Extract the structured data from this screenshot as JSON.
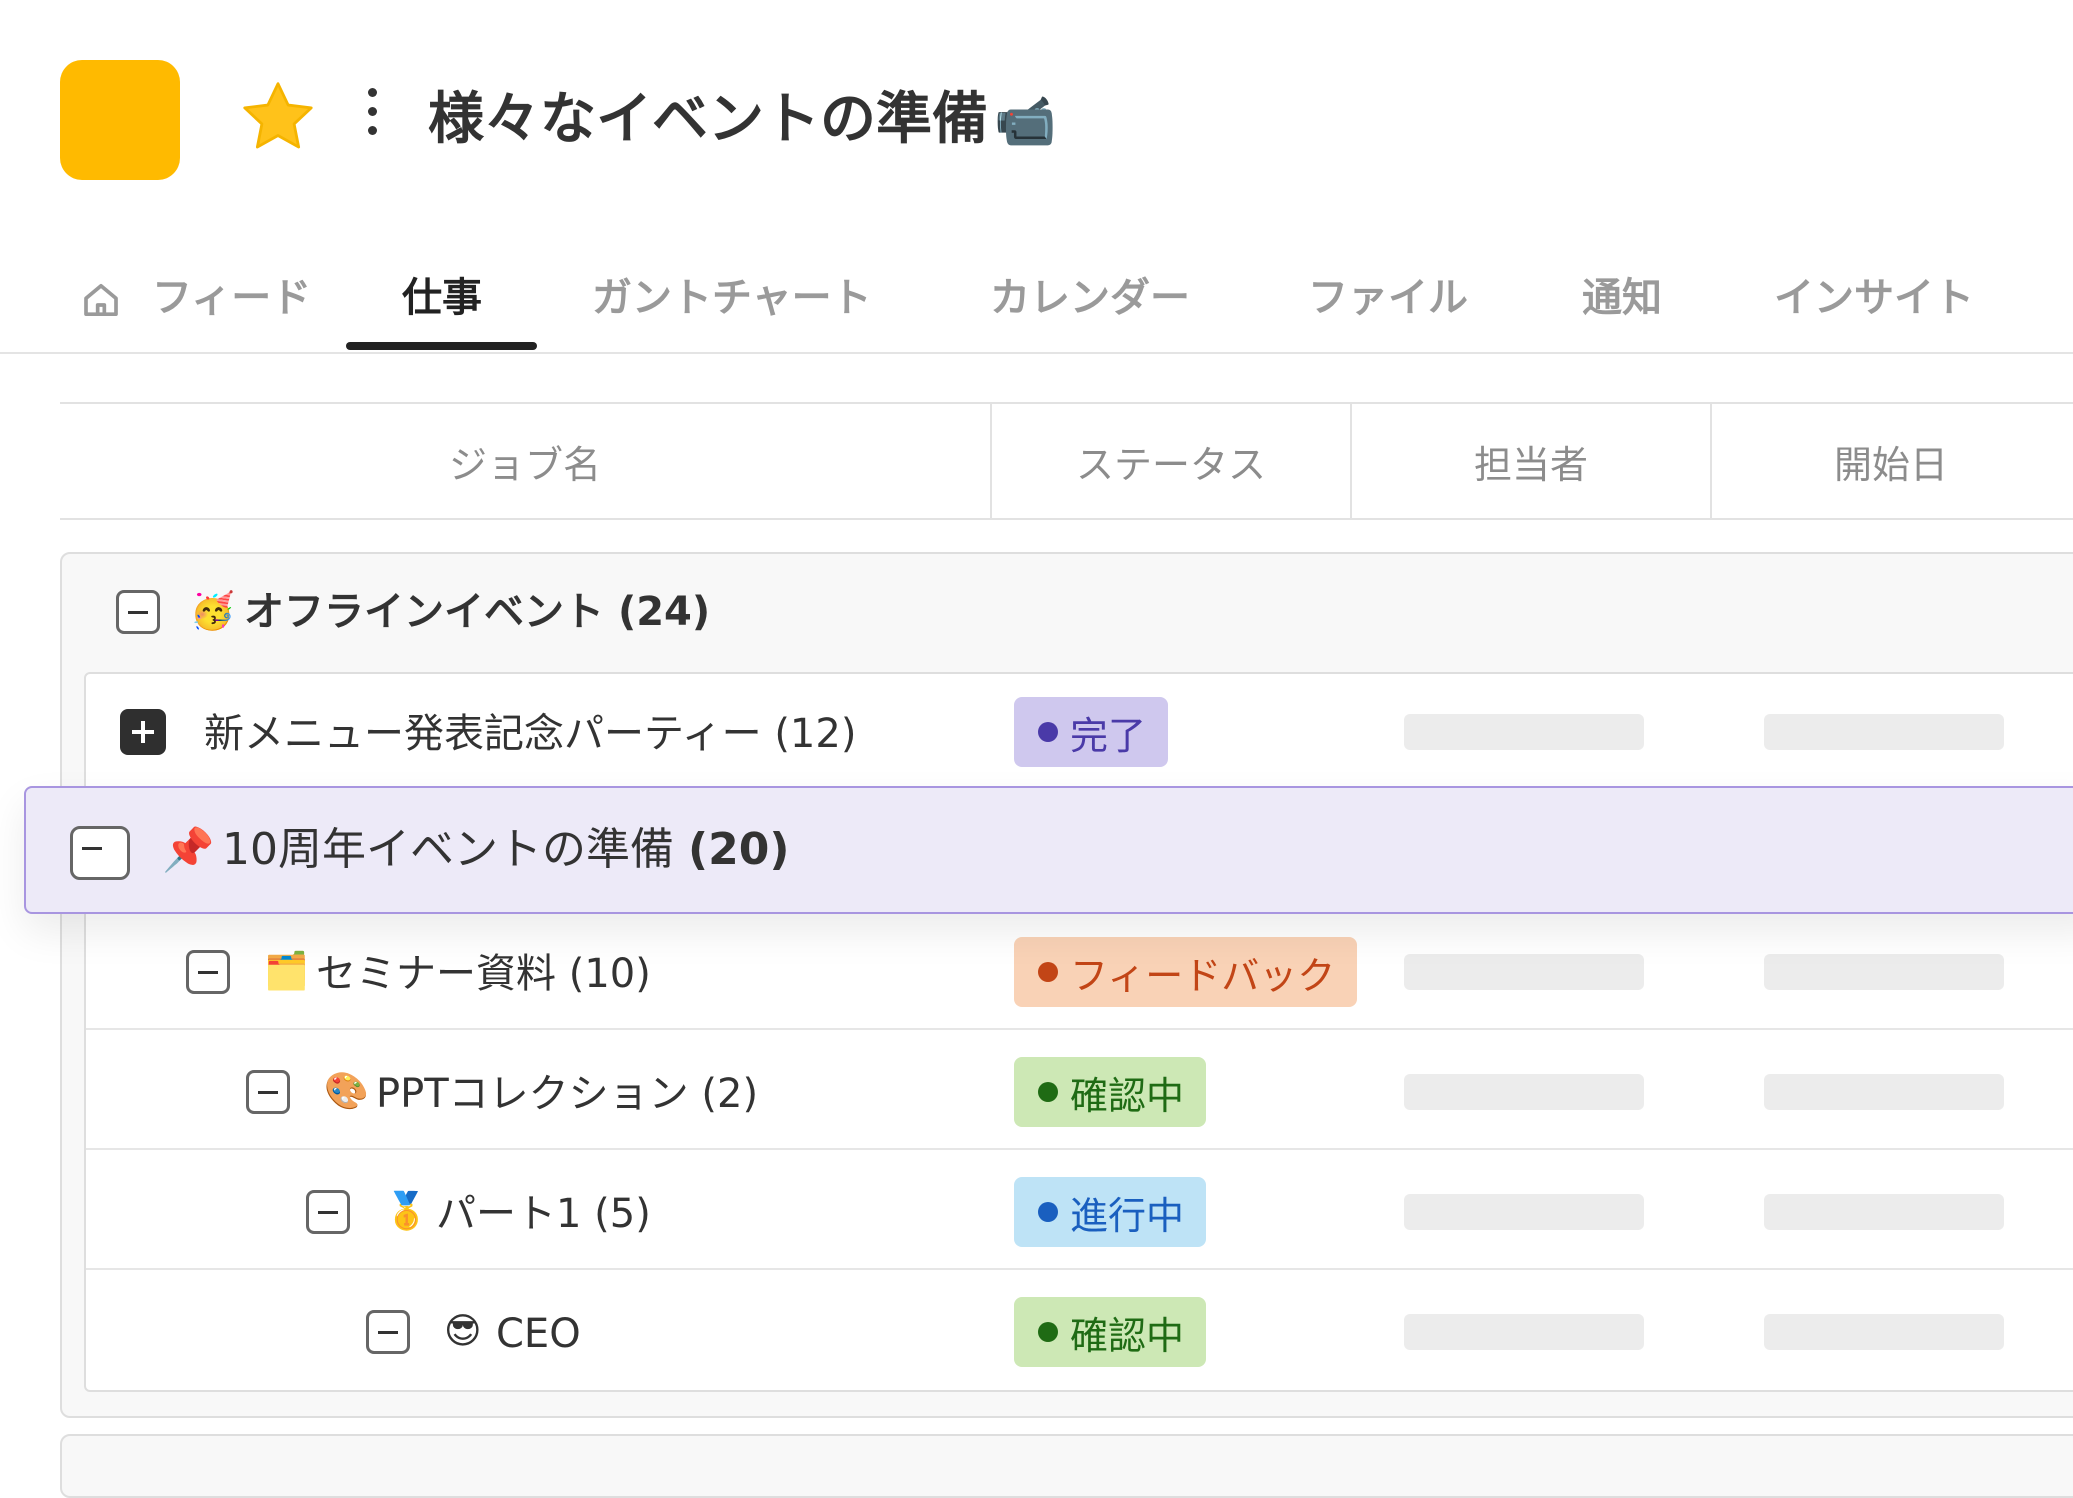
{
  "project": {
    "title": "様々なイベントの準備",
    "title_emoji": "📹",
    "icon_color": "#FFBA00"
  },
  "tabs": [
    {
      "label": "フィード",
      "icon": "home-icon"
    },
    {
      "label": "仕事",
      "active": true
    },
    {
      "label": "ガントチャート"
    },
    {
      "label": "カレンダー"
    },
    {
      "label": "ファイル"
    },
    {
      "label": "通知"
    },
    {
      "label": "インサイト"
    }
  ],
  "table": {
    "headers": [
      "ジョブ名",
      "ステータス",
      "担当者",
      "開始日"
    ],
    "group": {
      "emoji": "🥳",
      "name": "オフラインイベント",
      "count": "(24)"
    },
    "rows": [
      {
        "toggle": "expand",
        "emoji": "",
        "name": "新メニュー発表記念パーティー",
        "count": "(12)",
        "status": "完了",
        "status_color": "#4A3AA8",
        "status_bg": "#CFC8EE"
      },
      {
        "toggle": "collapse",
        "emoji": "📌",
        "name": "10周年イベントの準備",
        "count": "(20)",
        "pinned": true
      },
      {
        "toggle": "collapse",
        "emoji": "🗂️",
        "name": "セミナー資料",
        "count": "(10)",
        "status": "フィードバック",
        "status_color": "#C24516",
        "status_bg": "#F9D2B6"
      },
      {
        "toggle": "collapse",
        "emoji": "🎨",
        "name": "PPTコレクション",
        "count": "(2)",
        "status": "確認中",
        "status_color": "#1F6B14",
        "status_bg": "#CDE8B5"
      },
      {
        "toggle": "collapse",
        "emoji": "🥇",
        "name": "パート1",
        "count": "(5)",
        "status": "進行中",
        "status_color": "#1A5FBF",
        "status_bg": "#BEE3F6"
      },
      {
        "toggle": "collapse",
        "emoji": "😎",
        "name": "CEO",
        "count": "",
        "status": "確認中",
        "status_color": "#1F6B14",
        "status_bg": "#CDE8B5"
      }
    ]
  }
}
